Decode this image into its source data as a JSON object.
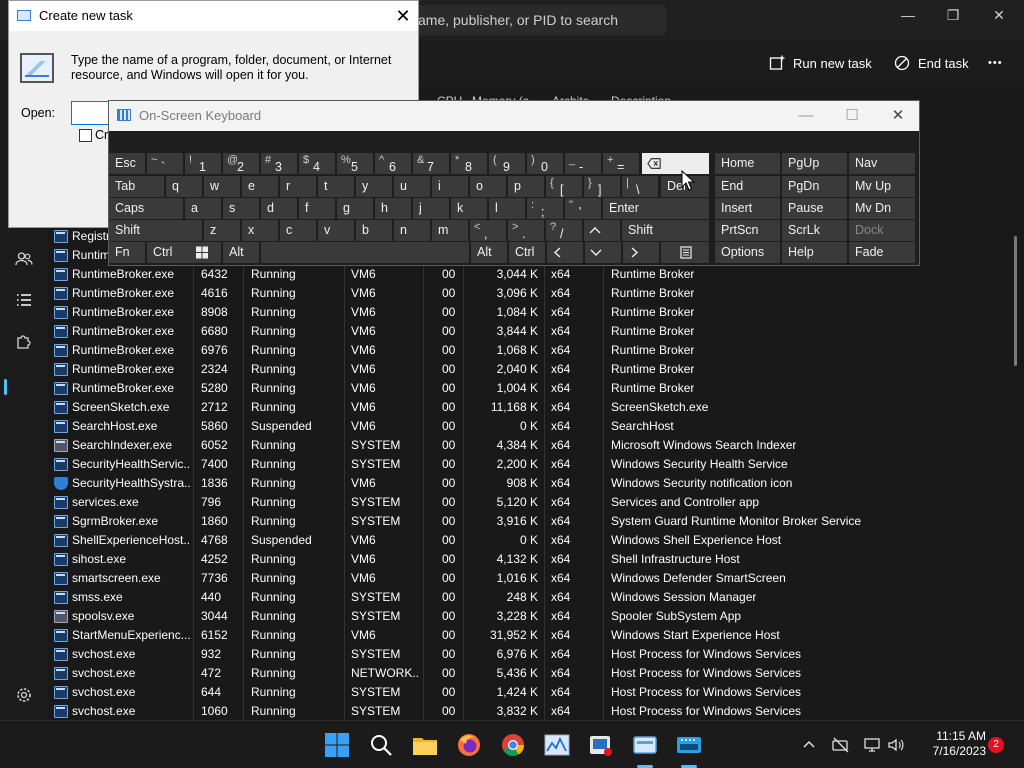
{
  "task_manager": {
    "search_placeholder": "ame, publisher, or PID to search",
    "run_new_task": "Run new task",
    "end_task": "End task",
    "more": "•••",
    "headers": {
      "cpu": "CPU",
      "memory": "Memory (a...",
      "architecture": "Archite...",
      "description": "Description"
    },
    "partial_rows": [
      "Registr",
      "Runtim"
    ],
    "rows": [
      {
        "name": "RuntimeBroker.exe",
        "pid": "6432",
        "status": "Running",
        "user": "VM6",
        "cpu": "00",
        "mem": "3,044 K",
        "arch": "x64",
        "desc": "Runtime Broker"
      },
      {
        "name": "RuntimeBroker.exe",
        "pid": "4616",
        "status": "Running",
        "user": "VM6",
        "cpu": "00",
        "mem": "3,096 K",
        "arch": "x64",
        "desc": "Runtime Broker"
      },
      {
        "name": "RuntimeBroker.exe",
        "pid": "8908",
        "status": "Running",
        "user": "VM6",
        "cpu": "00",
        "mem": "1,084 K",
        "arch": "x64",
        "desc": "Runtime Broker"
      },
      {
        "name": "RuntimeBroker.exe",
        "pid": "6680",
        "status": "Running",
        "user": "VM6",
        "cpu": "00",
        "mem": "3,844 K",
        "arch": "x64",
        "desc": "Runtime Broker"
      },
      {
        "name": "RuntimeBroker.exe",
        "pid": "6976",
        "status": "Running",
        "user": "VM6",
        "cpu": "00",
        "mem": "1,068 K",
        "arch": "x64",
        "desc": "Runtime Broker"
      },
      {
        "name": "RuntimeBroker.exe",
        "pid": "2324",
        "status": "Running",
        "user": "VM6",
        "cpu": "00",
        "mem": "2,040 K",
        "arch": "x64",
        "desc": "Runtime Broker"
      },
      {
        "name": "RuntimeBroker.exe",
        "pid": "5280",
        "status": "Running",
        "user": "VM6",
        "cpu": "00",
        "mem": "1,004 K",
        "arch": "x64",
        "desc": "Runtime Broker"
      },
      {
        "name": "ScreenSketch.exe",
        "pid": "2712",
        "status": "Running",
        "user": "VM6",
        "cpu": "00",
        "mem": "11,168 K",
        "arch": "x64",
        "desc": "ScreenSketch.exe"
      },
      {
        "name": "SearchHost.exe",
        "pid": "5860",
        "status": "Suspended",
        "user": "VM6",
        "cpu": "00",
        "mem": "0 K",
        "arch": "x64",
        "desc": "SearchHost"
      },
      {
        "name": "SearchIndexer.exe",
        "pid": "6052",
        "status": "Running",
        "user": "SYSTEM",
        "cpu": "00",
        "mem": "4,384 K",
        "arch": "x64",
        "desc": "Microsoft Windows Search Indexer"
      },
      {
        "name": "SecurityHealthServic...",
        "pid": "7400",
        "status": "Running",
        "user": "SYSTEM",
        "cpu": "00",
        "mem": "2,200 K",
        "arch": "x64",
        "desc": "Windows Security Health Service"
      },
      {
        "name": "SecurityHealthSystra...",
        "pid": "1836",
        "status": "Running",
        "user": "VM6",
        "cpu": "00",
        "mem": "908 K",
        "arch": "x64",
        "desc": "Windows Security notification icon"
      },
      {
        "name": "services.exe",
        "pid": "796",
        "status": "Running",
        "user": "SYSTEM",
        "cpu": "00",
        "mem": "5,120 K",
        "arch": "x64",
        "desc": "Services and Controller app"
      },
      {
        "name": "SgrmBroker.exe",
        "pid": "1860",
        "status": "Running",
        "user": "SYSTEM",
        "cpu": "00",
        "mem": "3,916 K",
        "arch": "x64",
        "desc": "System Guard Runtime Monitor Broker Service"
      },
      {
        "name": "ShellExperienceHost....",
        "pid": "4768",
        "status": "Suspended",
        "user": "VM6",
        "cpu": "00",
        "mem": "0 K",
        "arch": "x64",
        "desc": "Windows Shell Experience Host"
      },
      {
        "name": "sihost.exe",
        "pid": "4252",
        "status": "Running",
        "user": "VM6",
        "cpu": "00",
        "mem": "4,132 K",
        "arch": "x64",
        "desc": "Shell Infrastructure Host"
      },
      {
        "name": "smartscreen.exe",
        "pid": "7736",
        "status": "Running",
        "user": "VM6",
        "cpu": "00",
        "mem": "1,016 K",
        "arch": "x64",
        "desc": "Windows Defender SmartScreen"
      },
      {
        "name": "smss.exe",
        "pid": "440",
        "status": "Running",
        "user": "SYSTEM",
        "cpu": "00",
        "mem": "248 K",
        "arch": "x64",
        "desc": "Windows Session Manager"
      },
      {
        "name": "spoolsv.exe",
        "pid": "3044",
        "status": "Running",
        "user": "SYSTEM",
        "cpu": "00",
        "mem": "3,228 K",
        "arch": "x64",
        "desc": "Spooler SubSystem App"
      },
      {
        "name": "StartMenuExperienc...",
        "pid": "6152",
        "status": "Running",
        "user": "VM6",
        "cpu": "00",
        "mem": "31,952 K",
        "arch": "x64",
        "desc": "Windows Start Experience Host"
      },
      {
        "name": "svchost.exe",
        "pid": "932",
        "status": "Running",
        "user": "SYSTEM",
        "cpu": "00",
        "mem": "6,976 K",
        "arch": "x64",
        "desc": "Host Process for Windows Services"
      },
      {
        "name": "svchost.exe",
        "pid": "472",
        "status": "Running",
        "user": "NETWORK...",
        "cpu": "00",
        "mem": "5,436 K",
        "arch": "x64",
        "desc": "Host Process for Windows Services"
      },
      {
        "name": "svchost.exe",
        "pid": "644",
        "status": "Running",
        "user": "SYSTEM",
        "cpu": "00",
        "mem": "1,424 K",
        "arch": "x64",
        "desc": "Host Process for Windows Services"
      },
      {
        "name": "svchost.exe",
        "pid": "1060",
        "status": "Running",
        "user": "SYSTEM",
        "cpu": "00",
        "mem": "3,832 K",
        "arch": "x64",
        "desc": "Host Process for Windows Services"
      }
    ]
  },
  "run_dialog": {
    "title": "Create new task",
    "close": "✕",
    "message": "Type the name of a program, folder, document, or Internet resource, and Windows will open it for you.",
    "open_label": "Open:",
    "input_value": "",
    "checkbox_label": "Cr"
  },
  "osk": {
    "title": "On-Screen Keyboard",
    "row1": [
      {
        "n": "esc",
        "l": "Esc"
      },
      {
        "n": "backtick",
        "s": "~",
        "m": "`"
      },
      {
        "n": "1",
        "s": "!",
        "m": "1"
      },
      {
        "n": "2",
        "s": "@",
        "m": "2"
      },
      {
        "n": "3",
        "s": "#",
        "m": "3"
      },
      {
        "n": "4",
        "s": "$",
        "m": "4"
      },
      {
        "n": "5",
        "s": "%",
        "m": "5"
      },
      {
        "n": "6",
        "s": "^",
        "m": "6"
      },
      {
        "n": "7",
        "s": "&",
        "m": "7"
      },
      {
        "n": "8",
        "s": "*",
        "m": "8"
      },
      {
        "n": "9",
        "s": "(",
        "m": "9"
      },
      {
        "n": "0",
        "s": ")",
        "m": "0"
      },
      {
        "n": "minus",
        "s": "_",
        "m": "-"
      },
      {
        "n": "equals",
        "s": "+",
        "m": "="
      }
    ],
    "row2": [
      {
        "n": "tab",
        "l": "Tab"
      },
      {
        "n": "q",
        "l": "q"
      },
      {
        "n": "w",
        "l": "w"
      },
      {
        "n": "e",
        "l": "e"
      },
      {
        "n": "r",
        "l": "r"
      },
      {
        "n": "t",
        "l": "t"
      },
      {
        "n": "y",
        "l": "y"
      },
      {
        "n": "u",
        "l": "u"
      },
      {
        "n": "i",
        "l": "i"
      },
      {
        "n": "o",
        "l": "o"
      },
      {
        "n": "p",
        "l": "p"
      },
      {
        "n": "lbracket",
        "s": "{",
        "m": "["
      },
      {
        "n": "rbracket",
        "s": "}",
        "m": "]"
      },
      {
        "n": "backslash",
        "s": "|",
        "m": "\\"
      },
      {
        "n": "del",
        "l": "Del"
      }
    ],
    "row3": [
      {
        "n": "caps",
        "l": "Caps"
      },
      {
        "n": "a",
        "l": "a"
      },
      {
        "n": "s",
        "l": "s"
      },
      {
        "n": "d",
        "l": "d"
      },
      {
        "n": "f",
        "l": "f"
      },
      {
        "n": "g",
        "l": "g"
      },
      {
        "n": "h",
        "l": "h"
      },
      {
        "n": "j",
        "l": "j"
      },
      {
        "n": "k",
        "l": "k"
      },
      {
        "n": "l",
        "l": "l"
      },
      {
        "n": "semicolon",
        "s": ":",
        "m": ";"
      },
      {
        "n": "quote",
        "s": "\"",
        "m": "'"
      },
      {
        "n": "enter",
        "l": "Enter"
      }
    ],
    "row4": [
      {
        "n": "shift-left",
        "l": "Shift"
      },
      {
        "n": "z",
        "l": "z"
      },
      {
        "n": "x",
        "l": "x"
      },
      {
        "n": "c",
        "l": "c"
      },
      {
        "n": "v",
        "l": "v"
      },
      {
        "n": "b",
        "l": "b"
      },
      {
        "n": "n",
        "l": "n"
      },
      {
        "n": "m",
        "l": "m"
      },
      {
        "n": "comma",
        "s": "<",
        "m": ","
      },
      {
        "n": "period",
        "s": ">",
        "m": "."
      },
      {
        "n": "slash",
        "s": "?",
        "m": "/"
      },
      {
        "n": "shift-right",
        "l": "Shift"
      }
    ],
    "row5": [
      {
        "n": "fn",
        "l": "Fn"
      },
      {
        "n": "ctrl-left",
        "l": "Ctrl"
      },
      {
        "n": "alt-left",
        "l": "Alt"
      },
      {
        "n": "alt-right",
        "l": "Alt"
      },
      {
        "n": "ctrl-right",
        "l": "Ctrl"
      }
    ],
    "nav": [
      [
        "Home",
        "PgUp",
        "Nav"
      ],
      [
        "End",
        "PgDn",
        "Mv Up"
      ],
      [
        "Insert",
        "Pause",
        "Mv Dn"
      ],
      [
        "PrtScn",
        "ScrLk",
        "Dock"
      ],
      [
        "Options",
        "Help",
        "Fade"
      ]
    ]
  },
  "taskbar": {
    "time": "11:15 AM",
    "date": "7/16/2023",
    "notification_count": "2"
  }
}
